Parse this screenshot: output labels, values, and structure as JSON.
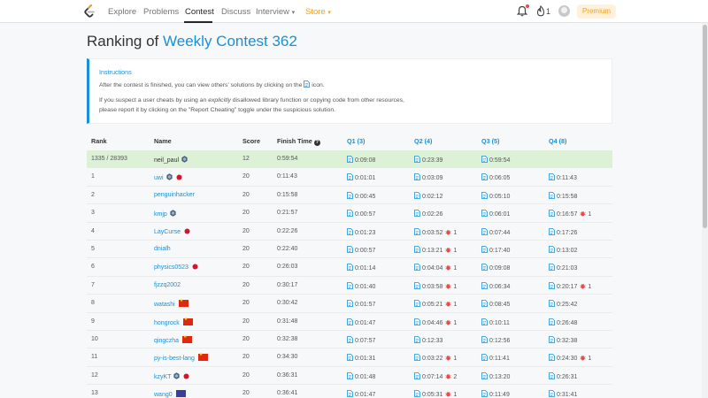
{
  "nav": {
    "items": [
      "Explore",
      "Problems",
      "Contest",
      "Discuss",
      "Interview",
      "Store"
    ],
    "streak": "1",
    "premium": "Premium"
  },
  "title": {
    "prefix": "Ranking of",
    "contest": "Weekly Contest 362"
  },
  "instructions": {
    "heading": "Instructions",
    "line1_a": "After the contest is finished, you can view others' solutions by clicking on the",
    "line1_b": "icon.",
    "line2_a": "If you suspect a user cheats by using an",
    "line2_em": "explicitly",
    "line2_b": "disallowed library function or copying code from other resources,",
    "line3": "please report it by clicking on the \"Report Cheating\" toggle under the suspicious solution."
  },
  "table": {
    "headers": {
      "rank": "Rank",
      "name": "Name",
      "score": "Score",
      "finish": "Finish Time",
      "q1": "Q1 (3)",
      "q2": "Q2 (4)",
      "q3": "Q3 (5)",
      "q4": "Q4 (8)"
    },
    "rows": [
      {
        "rank": "1335 / 28393",
        "name": "neil_paul",
        "badge": "hex",
        "flag": "",
        "score": "12",
        "finish": "0:59:54",
        "q1": "0:09:08",
        "q2": "0:23:39",
        "q2b": "",
        "q3": "0:59:54",
        "q4": "",
        "q4b": ""
      },
      {
        "rank": "1",
        "name": "uwi",
        "badge": "hex",
        "flag": "jp",
        "score": "20",
        "finish": "0:11:43",
        "q1": "0:01:01",
        "q2": "0:03:09",
        "q2b": "",
        "q3": "0:06:05",
        "q4": "0:11:43",
        "q4b": ""
      },
      {
        "rank": "2",
        "name": "penguinhacker",
        "badge": "",
        "flag": "",
        "score": "20",
        "finish": "0:15:58",
        "q1": "0:00:45",
        "q2": "0:02:12",
        "q2b": "",
        "q3": "0:05:10",
        "q4": "0:15:58",
        "q4b": ""
      },
      {
        "rank": "3",
        "name": "kmjp",
        "badge": "hex",
        "flag": "",
        "score": "20",
        "finish": "0:21:57",
        "q1": "0:00:57",
        "q2": "0:02:26",
        "q2b": "",
        "q3": "0:06:01",
        "q4": "0:16:57",
        "q4b": "1"
      },
      {
        "rank": "4",
        "name": "LayCurse",
        "badge": "",
        "flag": "jp",
        "score": "20",
        "finish": "0:22:26",
        "q1": "0:01:23",
        "q2": "0:03:52",
        "q2b": "1",
        "q3": "0:07:44",
        "q4": "0:17:26",
        "q4b": ""
      },
      {
        "rank": "5",
        "name": "dnialh",
        "badge": "",
        "flag": "",
        "score": "20",
        "finish": "0:22:40",
        "q1": "0:00:57",
        "q2": "0:13:21",
        "q2b": "1",
        "q3": "0:17:40",
        "q4": "0:13:02",
        "q4b": ""
      },
      {
        "rank": "6",
        "name": "physics0523",
        "badge": "",
        "flag": "jp",
        "score": "20",
        "finish": "0:26:03",
        "q1": "0:01:14",
        "q2": "0:04:04",
        "q2b": "1",
        "q3": "0:09:08",
        "q4": "0:21:03",
        "q4b": ""
      },
      {
        "rank": "7",
        "name": "fjzzq2002",
        "badge": "",
        "flag": "",
        "score": "20",
        "finish": "0:30:17",
        "q1": "0:01:40",
        "q2": "0:03:58",
        "q2b": "1",
        "q3": "0:06:34",
        "q4": "0:20:17",
        "q4b": "1"
      },
      {
        "rank": "8",
        "name": "watashi",
        "badge": "",
        "flag": "cn",
        "score": "20",
        "finish": "0:30:42",
        "q1": "0:01:57",
        "q2": "0:05:21",
        "q2b": "1",
        "q3": "0:08:45",
        "q4": "0:25:42",
        "q4b": ""
      },
      {
        "rank": "9",
        "name": "hongrock",
        "badge": "",
        "flag": "cn",
        "score": "20",
        "finish": "0:31:48",
        "q1": "0:01:47",
        "q2": "0:04:46",
        "q2b": "1",
        "q3": "0:10:11",
        "q4": "0:26:48",
        "q4b": ""
      },
      {
        "rank": "10",
        "name": "qingczha",
        "badge": "",
        "flag": "cn",
        "score": "20",
        "finish": "0:32:38",
        "q1": "0:07:57",
        "q2": "0:12:33",
        "q2b": "",
        "q3": "0:12:56",
        "q4": "0:32:38",
        "q4b": ""
      },
      {
        "rank": "11",
        "name": "py-is-best-lang",
        "badge": "",
        "flag": "cn",
        "score": "20",
        "finish": "0:34:30",
        "q1": "0:01:31",
        "q2": "0:03:22",
        "q2b": "1",
        "q3": "0:11:41",
        "q4": "0:24:30",
        "q4b": "1"
      },
      {
        "rank": "12",
        "name": "kzyKT",
        "badge": "hex",
        "flag": "jp",
        "score": "20",
        "finish": "0:36:31",
        "q1": "0:01:48",
        "q2": "0:07:14",
        "q2b": "2",
        "q3": "0:13:20",
        "q4": "0:26:31",
        "q4b": ""
      },
      {
        "rank": "13",
        "name": "wang0",
        "badge": "",
        "flag": "us",
        "score": "20",
        "finish": "0:36:41",
        "q1": "0:01:47",
        "q2": "0:05:31",
        "q2b": "1",
        "q3": "0:11:49",
        "q4": "0:31:41",
        "q4b": ""
      }
    ]
  }
}
